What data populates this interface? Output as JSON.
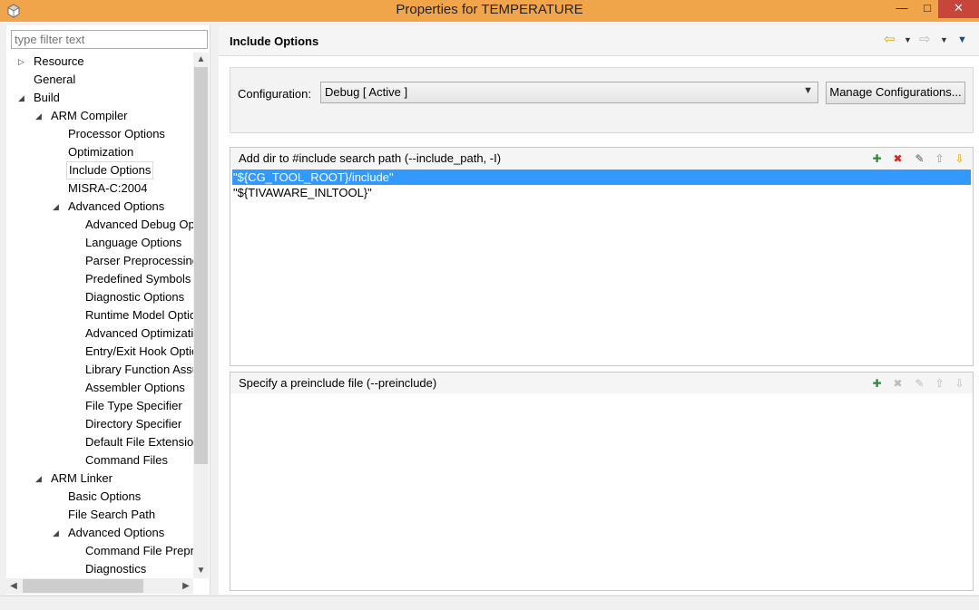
{
  "window": {
    "title": "Properties for TEMPERATURE",
    "minimize": "—",
    "maximize": "□",
    "close": "✕"
  },
  "filter": {
    "placeholder": "type filter text"
  },
  "tree": [
    {
      "label": "Resource",
      "level": 0,
      "arrow": "▷"
    },
    {
      "label": "General",
      "level": 0,
      "arrow": ""
    },
    {
      "label": "Build",
      "level": 0,
      "arrow": "◢"
    },
    {
      "label": "ARM Compiler",
      "level": 1,
      "arrow": "◢"
    },
    {
      "label": "Processor Options",
      "level": 2,
      "arrow": ""
    },
    {
      "label": "Optimization",
      "level": 2,
      "arrow": ""
    },
    {
      "label": "Include Options",
      "level": 2,
      "arrow": "",
      "selected": true
    },
    {
      "label": "MISRA-C:2004",
      "level": 2,
      "arrow": ""
    },
    {
      "label": "Advanced Options",
      "level": 2,
      "arrow": "◢"
    },
    {
      "label": "Advanced Debug Options",
      "level": 3,
      "arrow": ""
    },
    {
      "label": "Language Options",
      "level": 3,
      "arrow": ""
    },
    {
      "label": "Parser Preprocessing Options",
      "level": 3,
      "arrow": ""
    },
    {
      "label": "Predefined Symbols",
      "level": 3,
      "arrow": ""
    },
    {
      "label": "Diagnostic Options",
      "level": 3,
      "arrow": ""
    },
    {
      "label": "Runtime Model Options",
      "level": 3,
      "arrow": ""
    },
    {
      "label": "Advanced Optimizations",
      "level": 3,
      "arrow": ""
    },
    {
      "label": "Entry/Exit Hook Options",
      "level": 3,
      "arrow": ""
    },
    {
      "label": "Library Function Assumptions",
      "level": 3,
      "arrow": ""
    },
    {
      "label": "Assembler Options",
      "level": 3,
      "arrow": ""
    },
    {
      "label": "File Type Specifier",
      "level": 3,
      "arrow": ""
    },
    {
      "label": "Directory Specifier",
      "level": 3,
      "arrow": ""
    },
    {
      "label": "Default File Extensions",
      "level": 3,
      "arrow": ""
    },
    {
      "label": "Command Files",
      "level": 3,
      "arrow": ""
    },
    {
      "label": "ARM Linker",
      "level": 1,
      "arrow": "◢"
    },
    {
      "label": "Basic Options",
      "level": 2,
      "arrow": ""
    },
    {
      "label": "File Search Path",
      "level": 2,
      "arrow": ""
    },
    {
      "label": "Advanced Options",
      "level": 2,
      "arrow": "◢"
    },
    {
      "label": "Command File Preprocessing",
      "level": 3,
      "arrow": ""
    },
    {
      "label": "Diagnostics",
      "level": 3,
      "arrow": ""
    }
  ],
  "page": {
    "title": "Include Options",
    "back_icon": "⇦",
    "forward_icon": "⇨",
    "dropdown_icon": "▼",
    "menu_icon": "▼"
  },
  "config": {
    "label": "Configuration:",
    "value": "Debug  [ Active ]",
    "manage_label": "Manage Configurations..."
  },
  "include_paths": {
    "title": "Add dir to #include search path (--include_path, -I)",
    "items": [
      "\"${CG_TOOL_ROOT}/include\"",
      "\"${TIVAWARE_INLTOOL}\""
    ]
  },
  "preinclude": {
    "title": "Specify a preinclude file (--preinclude)",
    "items": []
  },
  "toolbar_icons": {
    "add": "✚",
    "delete": "✖",
    "edit": "✎",
    "up": "⇧",
    "down": "⇩"
  },
  "colors": {
    "titlebar": "#f1a54a",
    "close": "#c7463b",
    "selection": "#3399ff",
    "add_icon": "#2e8b3a",
    "delete_icon": "#d22",
    "down_icon": "#d8a400"
  }
}
